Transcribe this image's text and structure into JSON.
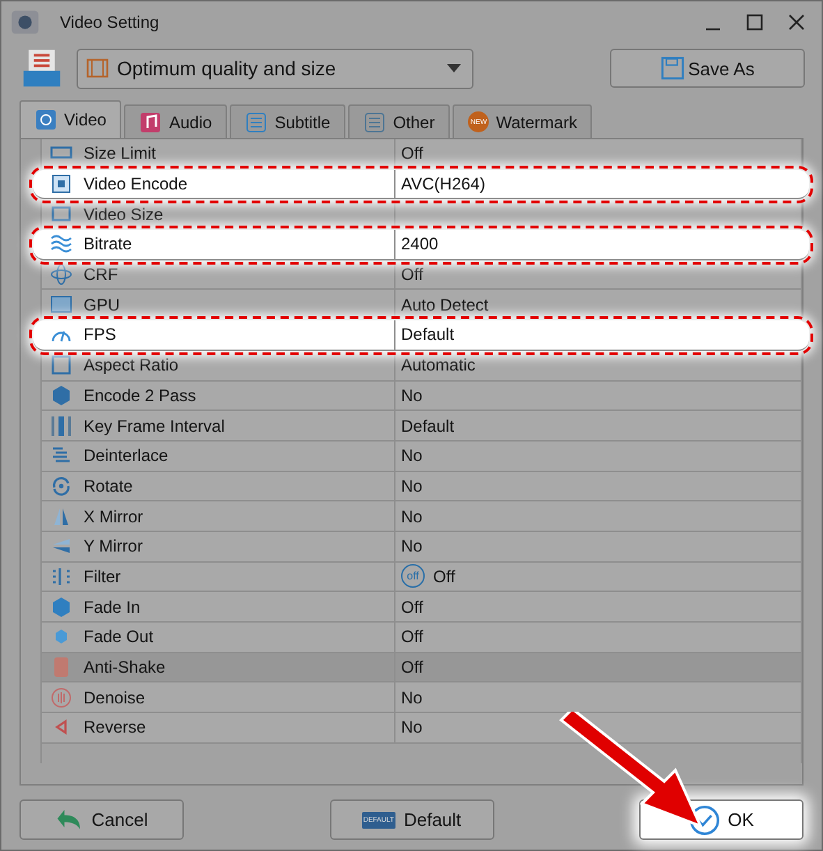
{
  "window": {
    "title": "Video Setting"
  },
  "profile": {
    "value": "Optimum quality and size"
  },
  "save_as": "Save As",
  "tabs": [
    {
      "label": "Video",
      "selected": true
    },
    {
      "label": "Audio",
      "selected": false
    },
    {
      "label": "Subtitle",
      "selected": false
    },
    {
      "label": "Other",
      "selected": false
    },
    {
      "label": "Watermark",
      "selected": false,
      "badge": "NEW"
    }
  ],
  "settings": [
    {
      "name": "Size Limit",
      "value": "Off",
      "highlighted": false,
      "selected": false
    },
    {
      "name": "Video Encode",
      "value": "AVC(H264)",
      "highlighted": true,
      "selected": false
    },
    {
      "name": "Video Size",
      "highlighted": false,
      "selected": false
    },
    {
      "name": "Bitrate",
      "value": "2400",
      "highlighted": true,
      "selected": false
    },
    {
      "name": "CRF",
      "value": "Off",
      "highlighted": false,
      "selected": false
    },
    {
      "name": "GPU",
      "value": "Auto Detect",
      "highlighted": false,
      "selected": false
    },
    {
      "name": "FPS",
      "value": "Default",
      "highlighted": true,
      "selected": false
    },
    {
      "name": "Aspect Ratio",
      "value": "Automatic",
      "highlighted": false,
      "selected": false
    },
    {
      "name": "Encode 2 Pass",
      "value": "No",
      "highlighted": false,
      "selected": false
    },
    {
      "name": "Key Frame Interval",
      "value": "Default",
      "highlighted": false,
      "selected": false
    },
    {
      "name": "Deinterlace",
      "value": "No",
      "highlighted": false,
      "selected": false
    },
    {
      "name": "Rotate",
      "value": "No",
      "highlighted": false,
      "selected": false
    },
    {
      "name": "X Mirror",
      "value": "No",
      "highlighted": false,
      "selected": false
    },
    {
      "name": "Y Mirror",
      "value": "No",
      "highlighted": false,
      "selected": false
    },
    {
      "name": "Filter",
      "value": "Off",
      "toggle": "off",
      "highlighted": false,
      "selected": false
    },
    {
      "name": "Fade In",
      "value": "Off",
      "highlighted": false,
      "selected": false
    },
    {
      "name": "Fade Out",
      "value": "Off",
      "highlighted": false,
      "selected": false
    },
    {
      "name": "Anti-Shake",
      "value": "Off",
      "highlighted": false,
      "selected": true
    },
    {
      "name": "Denoise",
      "value": "No",
      "highlighted": false,
      "selected": false
    },
    {
      "name": "Reverse",
      "value": "No",
      "highlighted": false,
      "selected": false
    }
  ],
  "buttons": [
    {
      "label": "Cancel",
      "highlighted": false
    },
    {
      "label": "Default",
      "icon_text": "DEFAULT",
      "highlighted": false
    },
    {
      "label": "OK",
      "highlighted": true
    }
  ],
  "pointer_arrow": true
}
